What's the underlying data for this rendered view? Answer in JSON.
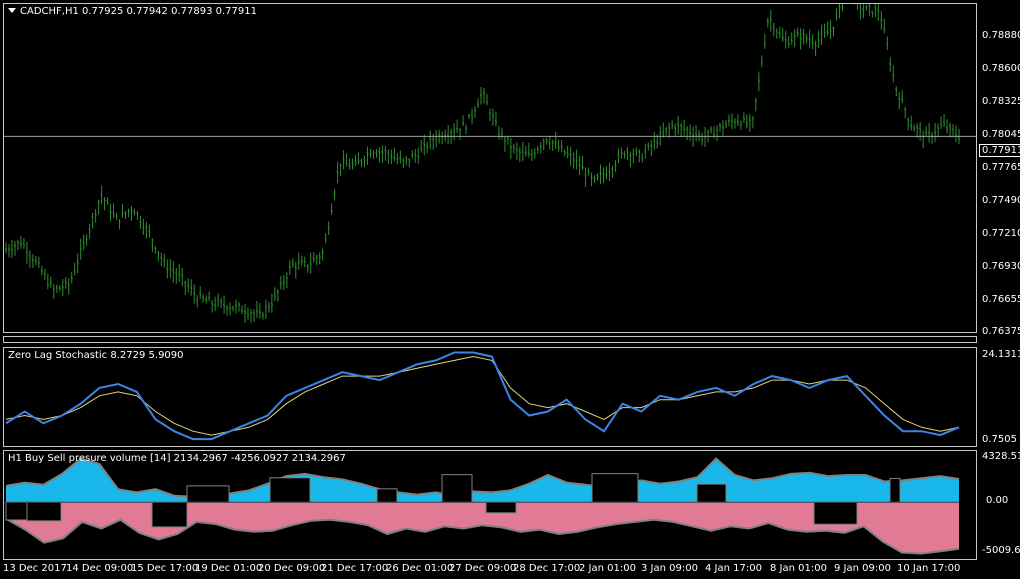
{
  "main": {
    "title": "CADCHF,H1  0.77925 0.77942 0.77893 0.77911",
    "y_labels": [
      "0.78880",
      "0.78600",
      "0.78325",
      "0.78045",
      "0.77765",
      "0.77490",
      "0.77210",
      "0.76930",
      "0.76655",
      "0.76375"
    ],
    "current_price": "0.77911"
  },
  "stoch": {
    "title": "Zero Lag Stochastic 8.2729 5.9090",
    "y_top": "24.1311",
    "y_bottom": "0.7505"
  },
  "vol": {
    "title": "H1 Buy Sell presure volume [14] 2134.2967 -4256.0927 2134.2967",
    "y_top": "4328.512",
    "y_mid": "0.00",
    "y_bottom": "-5009.613"
  },
  "x_labels": [
    "13 Dec 2017",
    "14 Dec 09:00",
    "15 Dec 17:00",
    "19 Dec 01:00",
    "20 Dec 09:00",
    "21 Dec 17:00",
    "26 Dec 01:00",
    "27 Dec 09:00",
    "28 Dec 17:00",
    "2 Jan 01:00",
    "3 Jan 09:00",
    "4 Jan 17:00",
    "8 Jan 01:00",
    "9 Jan 09:00",
    "10 Jan 17:00"
  ],
  "colors": {
    "candle": "#2f8f2f",
    "stoch_main": "#3a86e8",
    "stoch_signal": "#e8d27a",
    "buy": "#19b7ea",
    "sell": "#e07a95",
    "line": "#808080"
  },
  "chart_data": [
    {
      "type": "line",
      "title": "CADCHF,H1",
      "series": [
        {
          "values": [
            0.7702,
            0.7708,
            0.769,
            0.767,
            0.7675,
            0.771,
            0.7745,
            0.7725,
            0.7735,
            0.7715,
            0.769,
            0.768,
            0.7665,
            0.766,
            0.7658,
            0.7655,
            0.765,
            0.7665,
            0.769,
            0.769,
            0.77,
            0.777,
            0.7768,
            0.778,
            0.7778,
            0.777,
            0.7778,
            0.779,
            0.7795,
            0.78,
            0.7825,
            0.7795,
            0.778,
            0.7775,
            0.779,
            0.778,
            0.777,
            0.7755,
            0.7765,
            0.778,
            0.7775,
            0.7788,
            0.78,
            0.7795,
            0.779,
            0.7798,
            0.7804,
            0.78,
            0.7885,
            0.7865,
            0.787,
            0.7865,
            0.7875,
            0.7905,
            0.789,
            0.789,
            0.783,
            0.78,
            0.779,
            0.78,
            0.7791
          ]
        }
      ]
    },
    {
      "type": "line",
      "title": "Zero Lag Stochastic",
      "ylim": [
        0.7505,
        24.1311
      ],
      "series": [
        {
          "values": [
            6,
            9,
            6,
            8,
            11,
            15,
            16,
            14,
            7,
            4,
            2,
            2,
            4,
            6,
            8,
            13,
            15,
            17,
            19,
            18,
            17,
            19,
            21,
            22,
            24,
            24,
            23,
            12,
            8,
            9,
            12,
            7,
            4,
            11,
            9,
            13,
            12,
            14,
            15,
            13,
            16,
            18,
            17,
            15,
            17,
            18,
            13,
            8,
            4,
            4,
            3,
            5
          ]
        },
        {
          "values": [
            7,
            8,
            7,
            8,
            10,
            13,
            14,
            13,
            9,
            6,
            4,
            3,
            4,
            5,
            7,
            11,
            14,
            16,
            18,
            18,
            18,
            19,
            20,
            21,
            22,
            23,
            22,
            15,
            11,
            10,
            11,
            9,
            7,
            10,
            10,
            12,
            12,
            13,
            14,
            14,
            15,
            17,
            17,
            16,
            17,
            17,
            15,
            11,
            7,
            5,
            4,
            5
          ]
        }
      ]
    },
    {
      "type": "area",
      "title": "H1 Buy Sell presure volume [14]",
      "ylim": [
        -5009.613,
        4328.512
      ],
      "series": [
        {
          "values": [
            1500,
            1800,
            1600,
            2600,
            4000,
            3500,
            1200,
            900,
            1200,
            600,
            500,
            900,
            800,
            1100,
            1700,
            2400,
            2600,
            2300,
            2100,
            1700,
            1200,
            900,
            700,
            900,
            600,
            1000,
            900,
            1100,
            1700,
            2500,
            1800,
            1600,
            1400,
            1600,
            2000,
            1700,
            1900,
            2300,
            4000,
            2500,
            2000,
            2200,
            2600,
            2700,
            2400,
            2500,
            2500,
            1900,
            2000,
            2200,
            2400,
            2134
          ]
        },
        {
          "values": [
            -1500,
            -2500,
            -3700,
            -3300,
            -1800,
            -2400,
            -1600,
            -2800,
            -3400,
            -2900,
            -1800,
            -2000,
            -2500,
            -2700,
            -2600,
            -2100,
            -1700,
            -1600,
            -1800,
            -2100,
            -2900,
            -2400,
            -2700,
            -2200,
            -2400,
            -2100,
            -2300,
            -2700,
            -2500,
            -2900,
            -2700,
            -2300,
            -2000,
            -1800,
            -1600,
            -1800,
            -2200,
            -2600,
            -2200,
            -2400,
            -1900,
            -2500,
            -2700,
            -2600,
            -2800,
            -2200,
            -3600,
            -4600,
            -4700,
            -4500,
            -4256
          ]
        }
      ]
    }
  ]
}
